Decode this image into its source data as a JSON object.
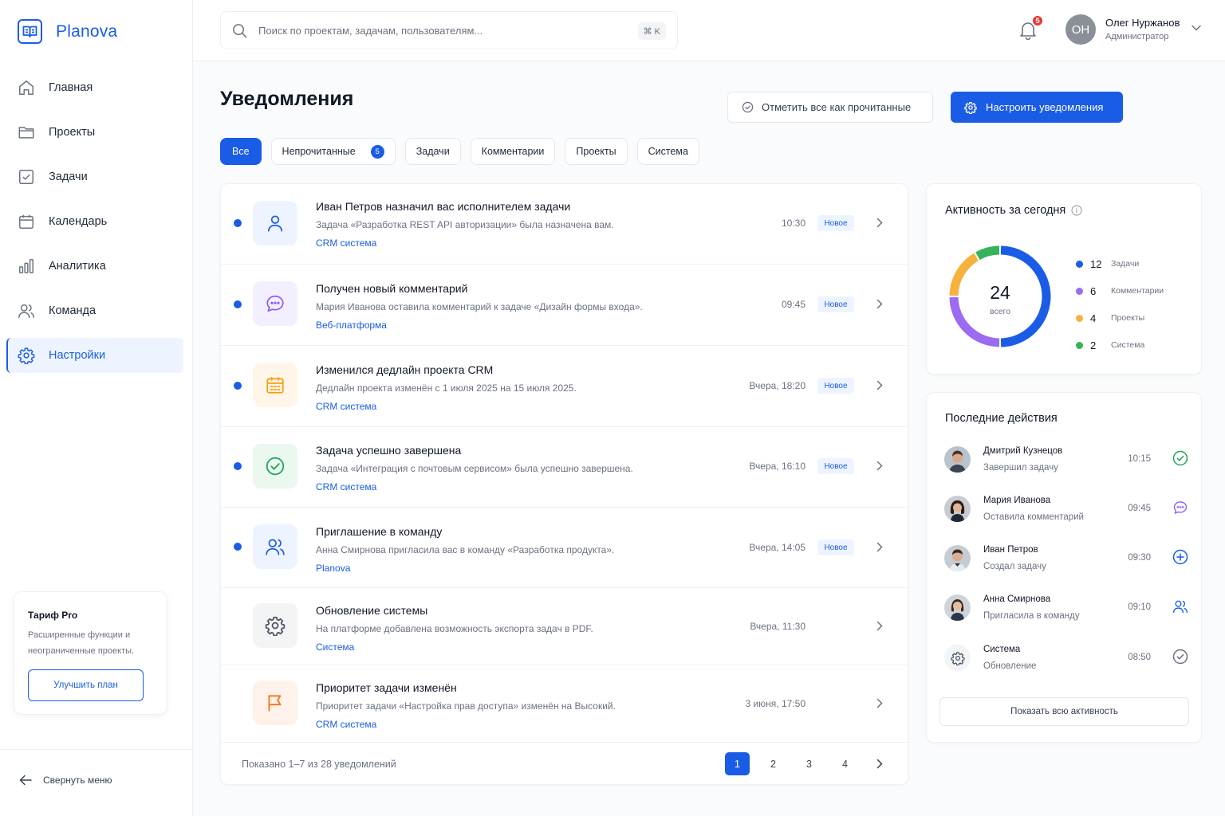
{
  "app": {
    "name": "Planova"
  },
  "sidebar": {
    "items": [
      {
        "label": "Главная",
        "icon": "home-icon"
      },
      {
        "label": "Проекты",
        "icon": "folder-icon"
      },
      {
        "label": "Задачи",
        "icon": "checkbox-icon"
      },
      {
        "label": "Календарь",
        "icon": "calendar-icon"
      },
      {
        "label": "Аналитика",
        "icon": "bar-chart-icon"
      },
      {
        "label": "Команда",
        "icon": "users-icon"
      },
      {
        "label": "Настройки",
        "icon": "gear-icon",
        "active": true
      }
    ],
    "plan": {
      "title": "Тариф Pro",
      "description_line1": "Расширенные функции и",
      "description_line2": "неограниченные проекты.",
      "button": "Улучшить план"
    },
    "collapse_label": "Свернуть меню"
  },
  "header": {
    "search_placeholder": "Поиск по проектам, задачам, пользователям...",
    "search_shortcut": "⌘ K",
    "notifications_count": "5",
    "user": {
      "initials": "ОН",
      "name": "Олег Нуржанов",
      "role": "Администратор"
    }
  },
  "page": {
    "title": "Уведомления",
    "mark_all_read": "Отметить все как прочитанные",
    "configure": "Настроить уведомления"
  },
  "filters": [
    {
      "label": "Все",
      "active": true
    },
    {
      "label": "Непрочитанные",
      "count": "5"
    },
    {
      "label": "Задачи"
    },
    {
      "label": "Комментарии"
    },
    {
      "label": "Проекты"
    },
    {
      "label": "Система"
    }
  ],
  "notifications": [
    {
      "title": "Иван Петров назначил вас исполнителем задачи",
      "description": "Задача «Разработка REST API авторизации» была назначена вам.",
      "project": "CRM система",
      "time": "10:30",
      "badge": "Новое",
      "unread": true,
      "icon": "user-icon",
      "color": "#1a5ce6"
    },
    {
      "title": "Получен новый комментарий",
      "description": "Мария Иванова оставила комментарий к задаче «Дизайн формы входа».",
      "project": "Веб-платформа",
      "time": "09:45",
      "badge": "Новое",
      "unread": true,
      "icon": "comment-icon",
      "color": "#8b5cf6"
    },
    {
      "title": "Изменился дедлайн проекта CRM",
      "description": "Дедлайн проекта изменён с 1 июля 2025 на 15 июля 2025.",
      "project": "CRM система",
      "time": "Вчера, 18:20",
      "badge": "Новое",
      "unread": true,
      "icon": "calendar-icon",
      "color": "#f59e0b"
    },
    {
      "title": "Задача успешно завершена",
      "description": "Задача «Интеграция с почтовым сервисом» была успешно завершена.",
      "project": "CRM система",
      "time": "Вчера, 16:10",
      "badge": "Новое",
      "unread": true,
      "icon": "check-circle-icon",
      "color": "#22a55a"
    },
    {
      "title": "Приглашение в команду",
      "description": "Анна Смирнова пригласила вас в команду «Разработка продукта».",
      "project": "Planova",
      "time": "Вчера, 14:05",
      "badge": "Новое",
      "unread": true,
      "icon": "users-icon",
      "color": "#1a5ce6"
    },
    {
      "title": "Обновление системы",
      "description": "На платформе добавлена возможность экспорта задач в PDF.",
      "project": "Система",
      "time": "Вчера, 11:30",
      "unread": false,
      "icon": "gear-icon",
      "color": "#4b5563"
    },
    {
      "title": "Приоритет задачи изменён",
      "description": "Приоритет задачи «Настройка прав доступа» изменён на Высокий.",
      "project": "CRM система",
      "time": "3 июня, 17:50",
      "unread": false,
      "icon": "flag-icon",
      "color": "#f97316"
    }
  ],
  "pagination": {
    "summary": "Показано 1–7 из 28 уведомлений",
    "pages": [
      "1",
      "2",
      "3",
      "4"
    ],
    "current": "1"
  },
  "activity": {
    "title": "Активность за сегодня",
    "total": "24",
    "total_label": "всего",
    "legend": [
      {
        "value": 12,
        "label": "Задачи",
        "color": "#1a5ce6"
      },
      {
        "value": 6,
        "label": "Комментарии",
        "color": "#9b6bf2"
      },
      {
        "value": 4,
        "label": "Проекты",
        "color": "#f6b23c"
      },
      {
        "value": 2,
        "label": "Система",
        "color": "#34b35a"
      }
    ]
  },
  "recent": {
    "title": "Последние действия",
    "items": [
      {
        "name": "Дмитрий Кузнецов",
        "action": "Завершил задачу",
        "time": "10:15",
        "icon": "check-circle-icon",
        "color": "#22a55a"
      },
      {
        "name": "Мария Иванова",
        "action": "Оставила комментарий",
        "time": "09:45",
        "icon": "comment-icon",
        "color": "#8b5cf6"
      },
      {
        "name": "Иван Петров",
        "action": "Создал задачу",
        "time": "09:30",
        "icon": "plus-circle-icon",
        "color": "#1a5ce6"
      },
      {
        "name": "Анна Смирнова",
        "action": "Пригласила в команду",
        "time": "09:10",
        "icon": "users-icon",
        "color": "#1a5ce6"
      },
      {
        "name": "Система",
        "action": "Обновление",
        "time": "08:50",
        "icon": "check-circle-icon",
        "color": "#6b7280"
      }
    ],
    "show_all": "Показать всю активность"
  }
}
